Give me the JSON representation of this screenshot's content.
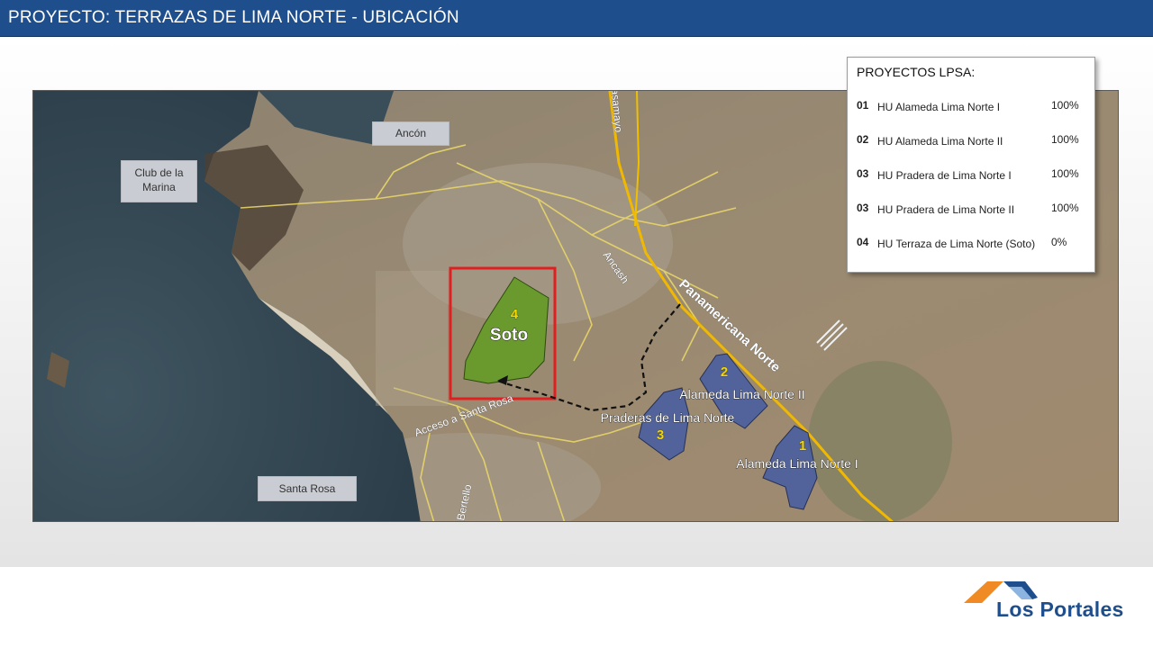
{
  "header": {
    "title": "PROYECTO:  TERRAZAS DE LIMA NORTE - UBICACIÓN"
  },
  "map": {
    "places": {
      "ancon": "Ancón",
      "club": "Club de la\nMarina",
      "santa_rosa": "Santa Rosa"
    },
    "roads": {
      "pasamayo": "Pasamayo",
      "ancash": "Ancash",
      "panamericana": "Panamericana Norte",
      "acceso": "Acceso a Santa Rosa",
      "bertello": "Bertello"
    },
    "projects": {
      "soto_num": "4",
      "soto_name": "Soto",
      "p2_num": "2",
      "p2_name": "Alameda Lima Norte II",
      "p3_num": "3",
      "p3_name": "Praderas de Lima Norte",
      "p1_num": "1",
      "p1_name": "Alameda Lima Norte I"
    },
    "colors": {
      "soto_fill": "#6a9a2e",
      "project_fill": "#4a5fa0",
      "highlight_box": "#e02020",
      "number_label": "#f5d800",
      "road": "#e8d66a",
      "highway": "#f0b800"
    }
  },
  "legend": {
    "title": "PROYECTOS LPSA:",
    "rows": [
      {
        "num": "01",
        "name": "HU Alameda Lima Norte I",
        "pct": "100%"
      },
      {
        "num": "02",
        "name": "HU Alameda Lima Norte II",
        "pct": "100%"
      },
      {
        "num": "03",
        "name": "HU Pradera de  Lima Norte I",
        "pct": "100%"
      },
      {
        "num": "03",
        "name": "HU Pradera de  Lima Norte II",
        "pct": "100%"
      },
      {
        "num": "04",
        "name": "HU Terraza  de  Lima Norte (Soto)",
        "pct": "0%"
      }
    ]
  },
  "logo": {
    "text": "Los Portales",
    "colors": {
      "roof": "#f08a24",
      "text": "#1f4e8c"
    }
  }
}
